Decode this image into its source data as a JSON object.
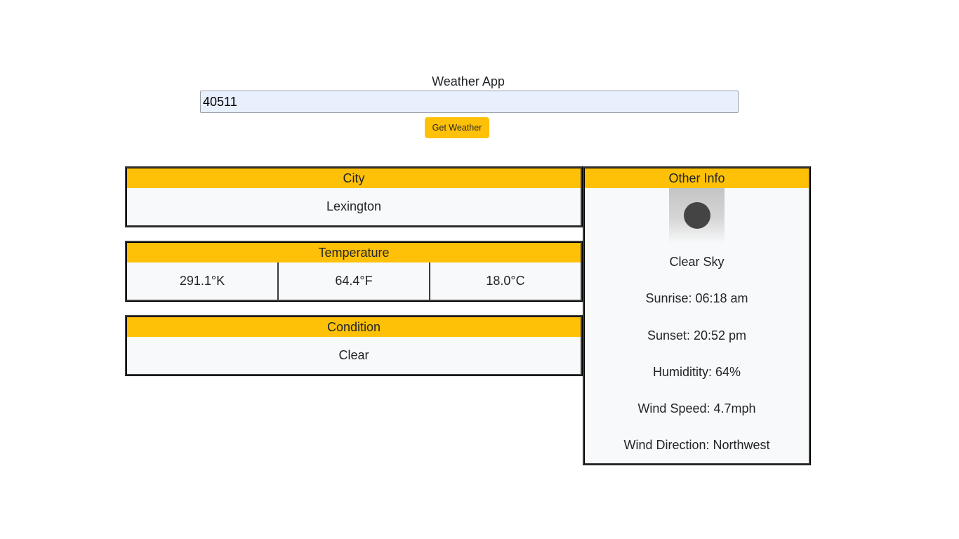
{
  "header": {
    "title": "Weather App"
  },
  "search": {
    "value": "40511",
    "button_label": "Get Weather"
  },
  "city": {
    "heading": "City",
    "value": "Lexington"
  },
  "temperature": {
    "heading": "Temperature",
    "kelvin": "291.1°K",
    "fahrenheit": "64.4°F",
    "celsius": "18.0°C"
  },
  "condition": {
    "heading": "Condition",
    "value": "Clear"
  },
  "other_info": {
    "heading": "Other Info",
    "icon": "clear-sky-icon",
    "description": "Clear Sky",
    "sunrise": "Sunrise: 06:18 am",
    "sunset": "Sunset: 20:52 pm",
    "humidity": "Humiditity: 64%",
    "wind_speed": "Wind Speed: 4.7mph",
    "wind_direction": "Wind Direction: Northwest"
  },
  "colors": {
    "accent": "#ffc107",
    "panel_bg": "#f8f9fa",
    "input_bg": "#e8f0fe"
  }
}
